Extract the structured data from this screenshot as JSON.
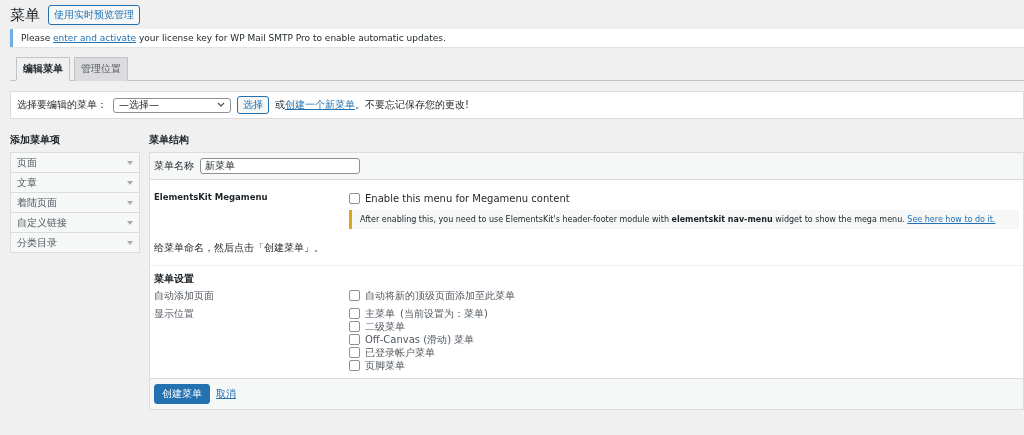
{
  "header": {
    "title": "菜单",
    "button": "使用实时预览管理"
  },
  "notice": {
    "before": "Please ",
    "link": "enter and activate",
    "after": " your license key for WP Mail SMTP Pro to enable automatic updates."
  },
  "tabs": [
    {
      "label": "编辑菜单",
      "selected": true
    },
    {
      "label": "管理位置",
      "selected": false
    }
  ],
  "menu_select": {
    "label": "选择要编辑的菜单：",
    "value": "—选择—",
    "button": "选择",
    "before": "或",
    "link": "创建一个新菜单",
    "after": "。不要忘记保存您的更改!"
  },
  "add_items": {
    "heading": "添加菜单项",
    "items": [
      {
        "label": "页面",
        "expanded": false
      },
      {
        "label": "文章",
        "expanded": false
      },
      {
        "label": "着陆页面",
        "expanded": false
      },
      {
        "label": "自定义链接",
        "expanded": false
      },
      {
        "label": "分类目录",
        "expanded": false
      }
    ]
  },
  "structure": {
    "heading": "菜单结构",
    "name_label": "菜单名称",
    "name_value": "新菜单",
    "megamenu": {
      "label": "ElementsKit Megamenu",
      "option": "Enable this menu for Megamenu content",
      "checked": false,
      "hint": "After enabling this, you need to use ElementsKit's header-footer module with **elementskit nav-menu** widget to show the mega menu. ",
      "hint_link": "See here how to do it."
    },
    "instruction": "给菜单命名，然后点击「创建菜单」。",
    "settings": {
      "heading": "菜单设置",
      "auto_label": "自动添加页面",
      "auto_option": {
        "label": "自动将新的顶级页面添加至此菜单",
        "checked": false
      },
      "locations_label": "显示位置",
      "locations": [
        {
          "label": "主菜单",
          "note": "(当前设置为：菜单)",
          "checked": false
        },
        {
          "label": "二级菜单",
          "checked": false
        },
        {
          "label": "Off-Canvas (滑动) 菜单",
          "checked": false
        },
        {
          "label": "已登录帐户菜单",
          "checked": false
        },
        {
          "label": "页脚菜单",
          "checked": false
        }
      ]
    },
    "save_button": "创建菜单",
    "cancel_link": "取消"
  }
}
